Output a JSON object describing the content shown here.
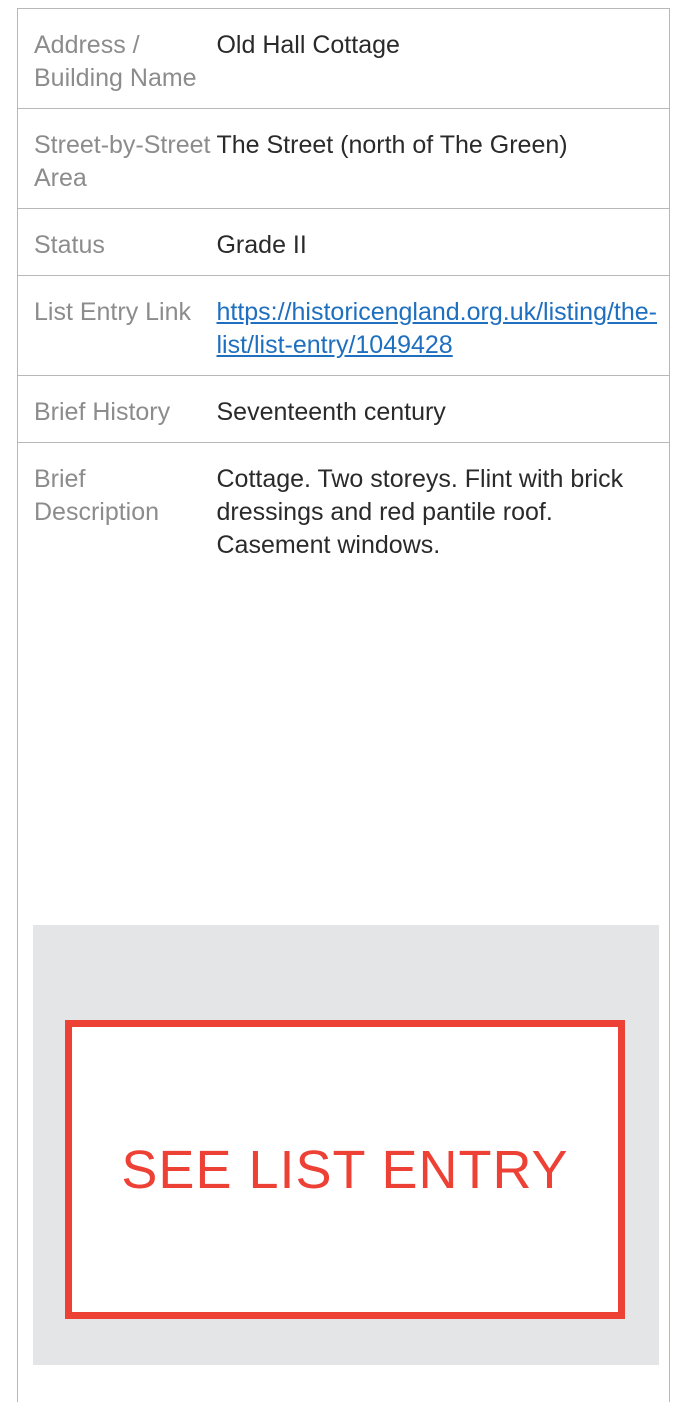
{
  "details": [
    {
      "label": "Address / Building Name",
      "value": "Old Hall Cottage"
    },
    {
      "label": "Street-by-Street Area",
      "value": "The Street (north of The Green)"
    },
    {
      "label": "Status",
      "value": "Grade II"
    },
    {
      "label": "List Entry Link",
      "value": "https://historicengland.org.uk/listing/the-list/list-entry/1049428"
    },
    {
      "label": "Brief History",
      "value": "Seventeenth century"
    },
    {
      "label": "Brief Description",
      "value": "Cottage. Two storeys. Flint with brick dressings and red pantile roof. Casement windows."
    }
  ],
  "cta": {
    "label": "SEE LIST ENTRY"
  },
  "colors": {
    "accent": "#ee4136",
    "link": "#1e6fbf",
    "label_text": "#8c8c8c",
    "value_text": "#2a2a2a",
    "panel_bg": "#e4e5e7",
    "rule": "#b8b8b8"
  }
}
